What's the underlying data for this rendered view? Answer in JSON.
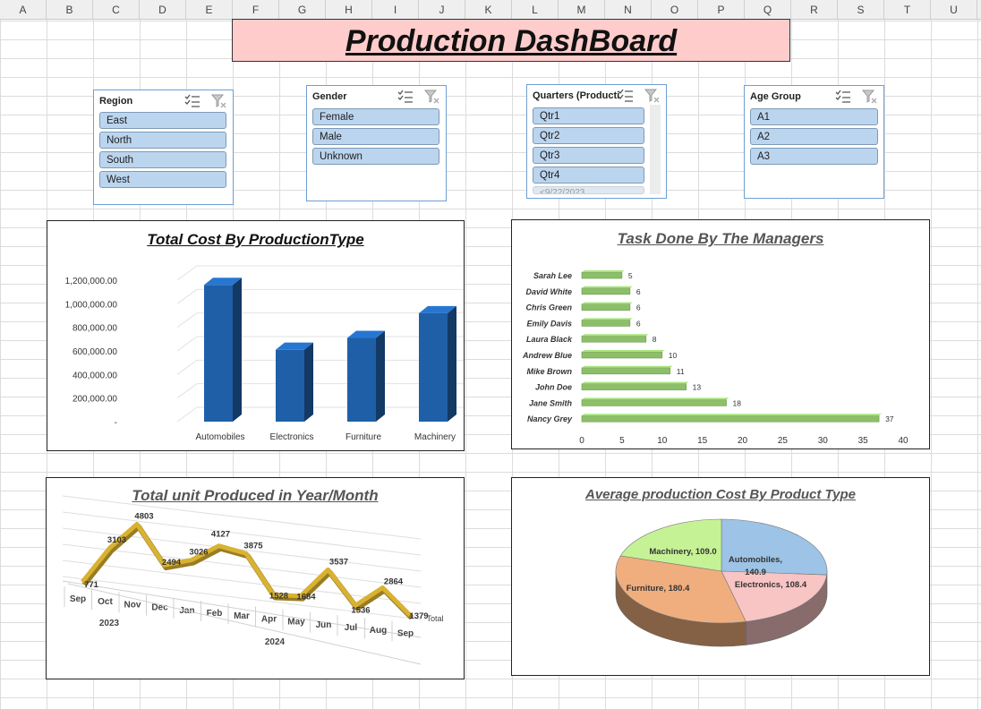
{
  "spreadsheet": {
    "columns": [
      "A",
      "B",
      "C",
      "D",
      "E",
      "F",
      "G",
      "H",
      "I",
      "J",
      "K",
      "L",
      "M",
      "N",
      "O",
      "P",
      "Q",
      "R",
      "S",
      "T",
      "U"
    ]
  },
  "dashboard": {
    "title": "Production DashBoard"
  },
  "slicers": {
    "region": {
      "title": "Region",
      "items": [
        "East",
        "North",
        "South",
        "West"
      ]
    },
    "gender": {
      "title": "Gender",
      "items": [
        "Female",
        "Male",
        "Unknown"
      ]
    },
    "quarters": {
      "title": "Quarters (Producti...",
      "items": [
        "Qtr1",
        "Qtr2",
        "Qtr3",
        "Qtr4",
        "<9/22/2023"
      ]
    },
    "age_group": {
      "title": "Age Group",
      "items": [
        "A1",
        "A2",
        "A3"
      ]
    }
  },
  "chart_data": [
    {
      "type": "bar",
      "title": "Total Cost By ProductionType",
      "categories": [
        "Automobiles",
        "Electronics",
        "Furniture",
        "Machinery"
      ],
      "values": [
        1160000,
        610000,
        710000,
        920000
      ],
      "ylim": [
        0,
        1200000
      ],
      "yticks": [
        "1,200,000.00",
        "1,000,000.00",
        "800,000.00",
        "600,000.00",
        "400,000.00",
        "200,000.00",
        "-"
      ],
      "color": "#1f5fa8",
      "style": "3d-column"
    },
    {
      "type": "bar",
      "orientation": "horizontal",
      "title": "Task Done By The Managers",
      "categories": [
        "Sarah Lee",
        "David White",
        "Chris Green",
        "Emily Davis",
        "Laura Black",
        "Andrew Blue",
        "Mike Brown",
        "John Doe",
        "Jane Smith",
        "Nancy Grey"
      ],
      "values": [
        5,
        6,
        6,
        6,
        8,
        10,
        11,
        13,
        18,
        37
      ],
      "xlim": [
        0,
        40
      ],
      "xticks": [
        "0",
        "5",
        "10",
        "15",
        "20",
        "25",
        "30",
        "35",
        "40"
      ],
      "color": "#8dbf6a"
    },
    {
      "type": "line",
      "title": "Total unit Produced in Year/Month",
      "categories": [
        "Sep",
        "Oct",
        "Nov",
        "Dec",
        "Jan",
        "Feb",
        "Mar",
        "Apr",
        "May",
        "Jun",
        "Jul",
        "Aug",
        "Sep"
      ],
      "groups": [
        {
          "label": "2023"
        },
        {
          "label": "2024"
        }
      ],
      "series": [
        {
          "name": "Total",
          "values": [
            771,
            3103,
            4803,
            2494,
            3026,
            4127,
            3875,
            1528,
            1684,
            3537,
            1536,
            2864,
            1379
          ]
        }
      ],
      "value_labels": [
        "771",
        "3103",
        "4803",
        "2494",
        "3026",
        "4127",
        "3875",
        "1528",
        "1684",
        "3537",
        "1536",
        "2864",
        "1379"
      ],
      "color": "#d9b232",
      "style": "3d-line"
    },
    {
      "type": "pie",
      "title": "Average production Cost By Product Type",
      "categories": [
        "Automobiles",
        "Electronics",
        "Furniture",
        "Machinery"
      ],
      "values": [
        140.9,
        108.4,
        180.4,
        109.0
      ],
      "labels": [
        "Automobiles,",
        "140.9",
        "Electronics, 108.4",
        "Furniture, 180.4",
        "Machinery, 109.0"
      ],
      "colors": [
        "#9dc3e6",
        "#f8c4c4",
        "#f0ae7e",
        "#c6f296"
      ],
      "style": "3d-pie"
    }
  ]
}
